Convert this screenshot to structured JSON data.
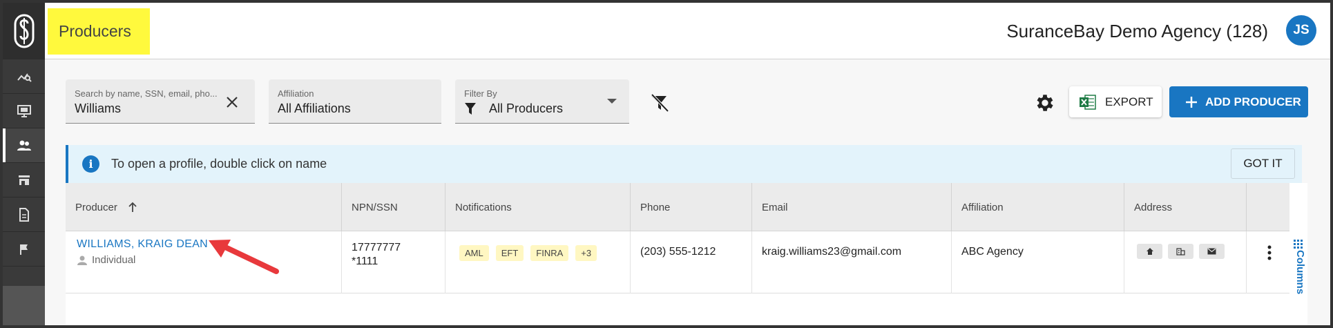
{
  "header": {
    "page_title": "Producers",
    "agency": "SuranceBay Demo Agency (128)",
    "avatar_initials": "JS"
  },
  "filters": {
    "search": {
      "label": "Search by name, SSN, email, pho...",
      "value": "Williams"
    },
    "affiliation": {
      "label": "Affiliation",
      "value": "All Affiliations"
    },
    "filter_by": {
      "label": "Filter By",
      "value": "All Producers"
    }
  },
  "toolbar": {
    "export_label": "EXPORT",
    "add_label": "ADD PRODUCER"
  },
  "banner": {
    "text": "To open a profile, double click on name",
    "button": "GOT IT"
  },
  "table": {
    "columns": [
      "Producer",
      "NPN/SSN",
      "Notifications",
      "Phone",
      "Email",
      "Affiliation",
      "Address"
    ],
    "rows": [
      {
        "name": "WILLIAMS, KRAIG DEAN",
        "type": "Individual",
        "npn": "17777777",
        "ssn": "*1111",
        "notifications": [
          "AML",
          "EFT",
          "FINRA",
          "+3"
        ],
        "phone": "(203) 555-1212",
        "email": "kraig.williams23@gmail.com",
        "affiliation": "ABC Agency"
      }
    ]
  },
  "columns_panel_label": "Columns",
  "colors": {
    "accent": "#1976c2",
    "highlight": "#fff93d",
    "sidebar": "#3a3a3a",
    "annotation_arrow": "#e8393c"
  }
}
